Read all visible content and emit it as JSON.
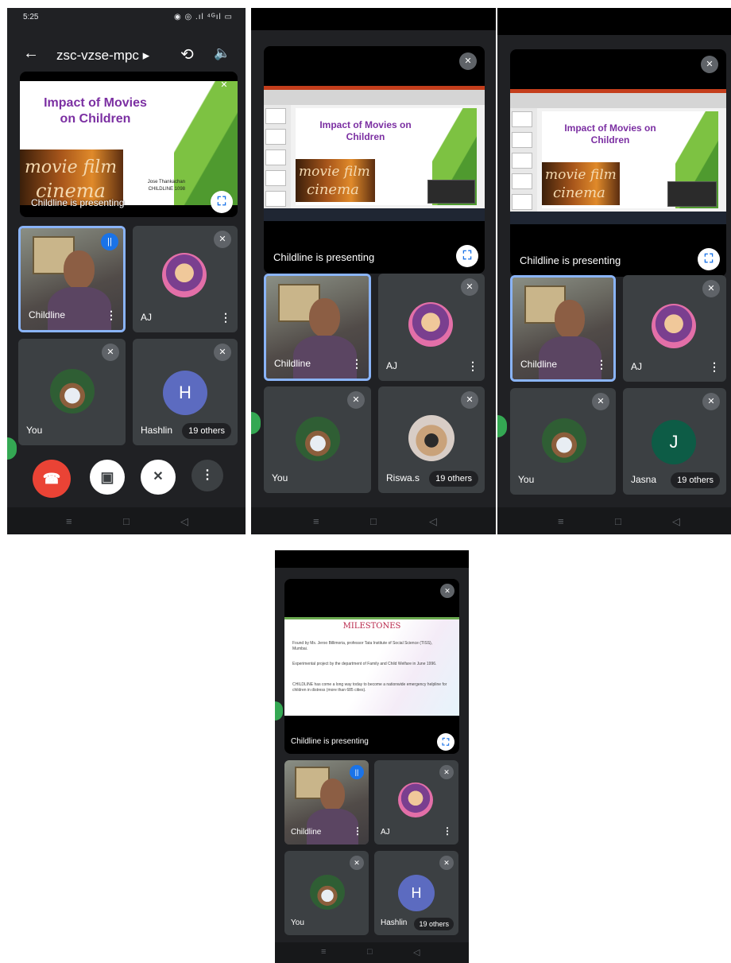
{
  "p1": {
    "status": {
      "time": "5:25",
      "icons": "◉ ◎ .ıl ⁴ᴳıl ▭"
    },
    "meeting_code": "zsc-vzse-mpc ▸",
    "slide": {
      "title": "Impact of Movies on Children",
      "film_word1": "movie film",
      "film_word2": "cinema",
      "author": "Jose Thankachan",
      "author2": "CHILDLINE 1098"
    },
    "presenting_label": "Childline is presenting",
    "tiles": {
      "childline": "Childline",
      "aj": "AJ",
      "you": "You",
      "hashlin": "Hashlin",
      "hashlin_letter": "H",
      "others": "19 others"
    }
  },
  "p2": {
    "slide_title": "Impact of Movies on Children",
    "film_word1": "movie film",
    "film_word2": "cinema",
    "presenting_label": "Childline is presenting",
    "tiles": {
      "childline": "Childline",
      "aj": "AJ",
      "you": "You",
      "riswa": "Riswa.s",
      "others": "19 others"
    }
  },
  "p3": {
    "slide_title": "Impact of Movies on Children",
    "film_word1": "movie film",
    "film_word2": "cinema",
    "presenting_label": "Childline is presenting",
    "tiles": {
      "childline": "Childline",
      "aj": "AJ",
      "you": "You",
      "jasna": "Jasna",
      "jasna_letter": "J",
      "others": "19 others"
    }
  },
  "p4": {
    "slide_title": "MILESTONES",
    "bullets": [
      "Found by Ms. Jeroo Billimoria, professor Tata Institute of Social Science (TISS), Mumbai.",
      "Experimental project by the department of Family and Child Welfare in June 1996.",
      "CHILDLINE has come a long way today to become a nationwide emergency helpline for children in distress (more than 685 cities)."
    ],
    "presenting_label": "Childline is presenting",
    "tiles": {
      "childline": "Childline",
      "aj": "AJ",
      "you": "You",
      "hashlin": "Hashlin",
      "hashlin_letter": "H",
      "others": "19 others"
    }
  },
  "glyphs": {
    "back": "←",
    "switch_cam": "⟲",
    "speaker": "🔈",
    "mic_off": "✕",
    "fullscreen": "⛶",
    "dots": "⋮",
    "hangup": "☎",
    "cam_off": "▣",
    "more": "⋮",
    "nav_recent": "≡",
    "nav_home": "□",
    "nav_back": "◁",
    "speaking": "||"
  },
  "colors": {
    "meet_bg": "#202124",
    "tile_bg": "#3c4043",
    "hangup_red": "#ea4335",
    "active_border": "#8ab4f8",
    "avatar_h": "#5c6bc0",
    "avatar_j": "#0d5c46"
  }
}
